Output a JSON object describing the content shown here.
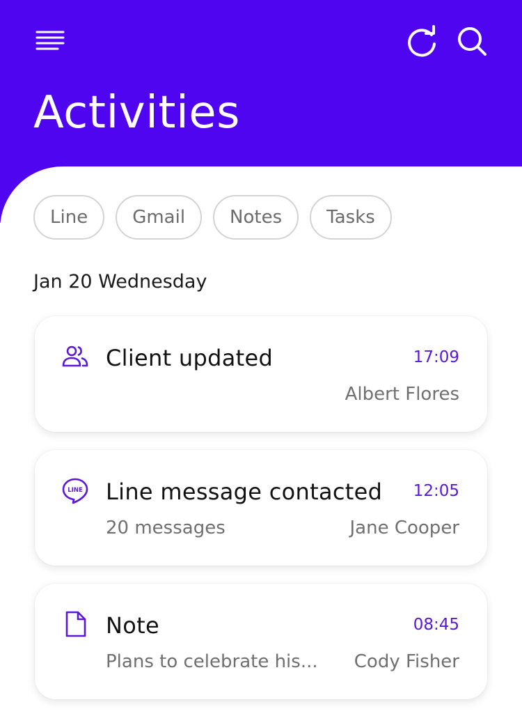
{
  "header": {
    "title": "Activities",
    "background_color": "#4F05EF",
    "menu_icon": "menu-icon",
    "refresh_icon": "refresh-icon",
    "search_icon": "search-icon"
  },
  "filters": [
    {
      "label": "Line"
    },
    {
      "label": "Gmail"
    },
    {
      "label": "Notes"
    },
    {
      "label": "Tasks"
    }
  ],
  "date_header": "Jan 20 Wednesday",
  "accent_color": "#5B17D8",
  "activities": [
    {
      "icon": "users-icon",
      "title": "Client updated",
      "time": "17:09",
      "subtitle": "",
      "person": "Albert Flores"
    },
    {
      "icon": "line-chat-icon",
      "icon_text": "LINE",
      "title": "Line message contacted",
      "time": "12:05",
      "subtitle": "20 messages",
      "person": "Jane Cooper"
    },
    {
      "icon": "note-icon",
      "title": "Note",
      "time": "08:45",
      "subtitle": "Plans to celebrate his...",
      "person": "Cody Fisher"
    }
  ]
}
